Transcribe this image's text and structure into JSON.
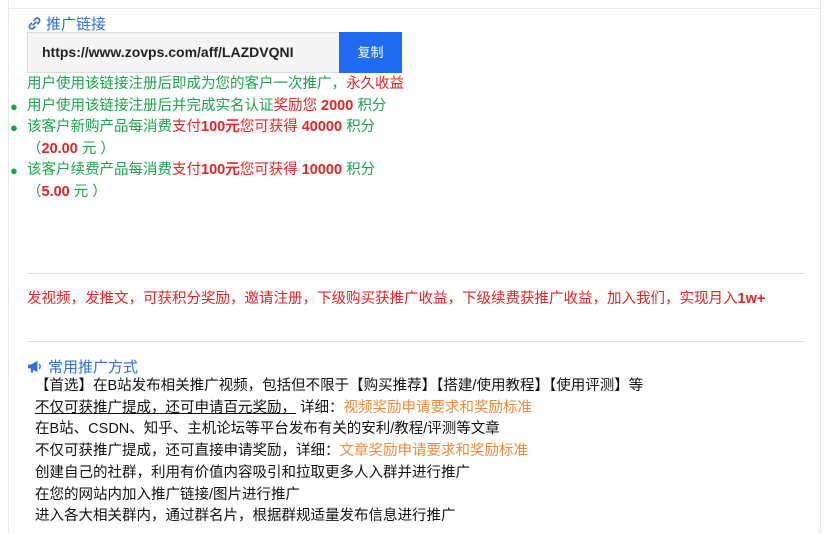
{
  "link_section": {
    "title": "推广链接",
    "url": "https://www.zovps.com/aff/LAZDVQNI",
    "copy_label": "复制"
  },
  "rules": {
    "intro": {
      "text": "用户使用该链接注册后即成为您的客户一次推广，",
      "highlight": "永久收益"
    },
    "items": [
      {
        "pre": "用户使用该链接注册后并完成实名认证",
        "mid": "奖励您 ",
        "amount": "2000",
        "post": " 积分"
      },
      {
        "pre": "该客户新购产品每消费",
        "mid": "支付",
        "amount": "100元",
        "mid2": "您可获得 ",
        "amount2": "40000",
        "post": " 积分（",
        "extra": "20.00",
        "end": " 元 ）"
      },
      {
        "pre": "该客户续费产品每消费",
        "mid": "支付",
        "amount": "100元",
        "mid2": "您可获得 ",
        "amount2": "10000",
        "post": " 积分（",
        "extra": "5.00",
        "end": " 元 ）"
      }
    ]
  },
  "promo": {
    "text": "发视频，发推文，可获积分奖励，邀请注册，下级购买获推广收益，下级续费获推广收益，加入我们，实现月入",
    "bold": "1w+"
  },
  "common": {
    "title": "常用推广方式",
    "rows": [
      {
        "text": "【首选】在B站发布相关推广视频，包括但不限于【购买推荐】【搭建/使用教程】【使用评测】等"
      },
      {
        "underline": "不仅可获推广提成，还可申请百元奖励，",
        "text": " 详细：",
        "link": "视频奖励申请要求和奖励标准"
      },
      {
        "text": "在B站、CSDN、知乎、主机论坛等平台发布有关的安利/教程/评测等文章"
      },
      {
        "text": "不仅可获推广提成，还可直接申请奖励，详细：",
        "link": "文章奖励申请要求和奖励标准"
      },
      {
        "text": "创建自己的社群，利用有价值内容吸引和拉取更多人入群并进行推广"
      },
      {
        "text": "在您的网站内加入推广链接/图片进行推广"
      },
      {
        "text": "进入各大相关群内，通过群名片，根据群规适量发布信息进行推广"
      }
    ]
  },
  "colors": {
    "accent_blue": "#2f6fd6",
    "button_blue": "#1f6cf2",
    "green": "#1aa34a",
    "red": "#e22424",
    "orange": "#f0893a"
  },
  "icons": {
    "link_title": "link-icon",
    "common_title": "megaphone-icon"
  }
}
